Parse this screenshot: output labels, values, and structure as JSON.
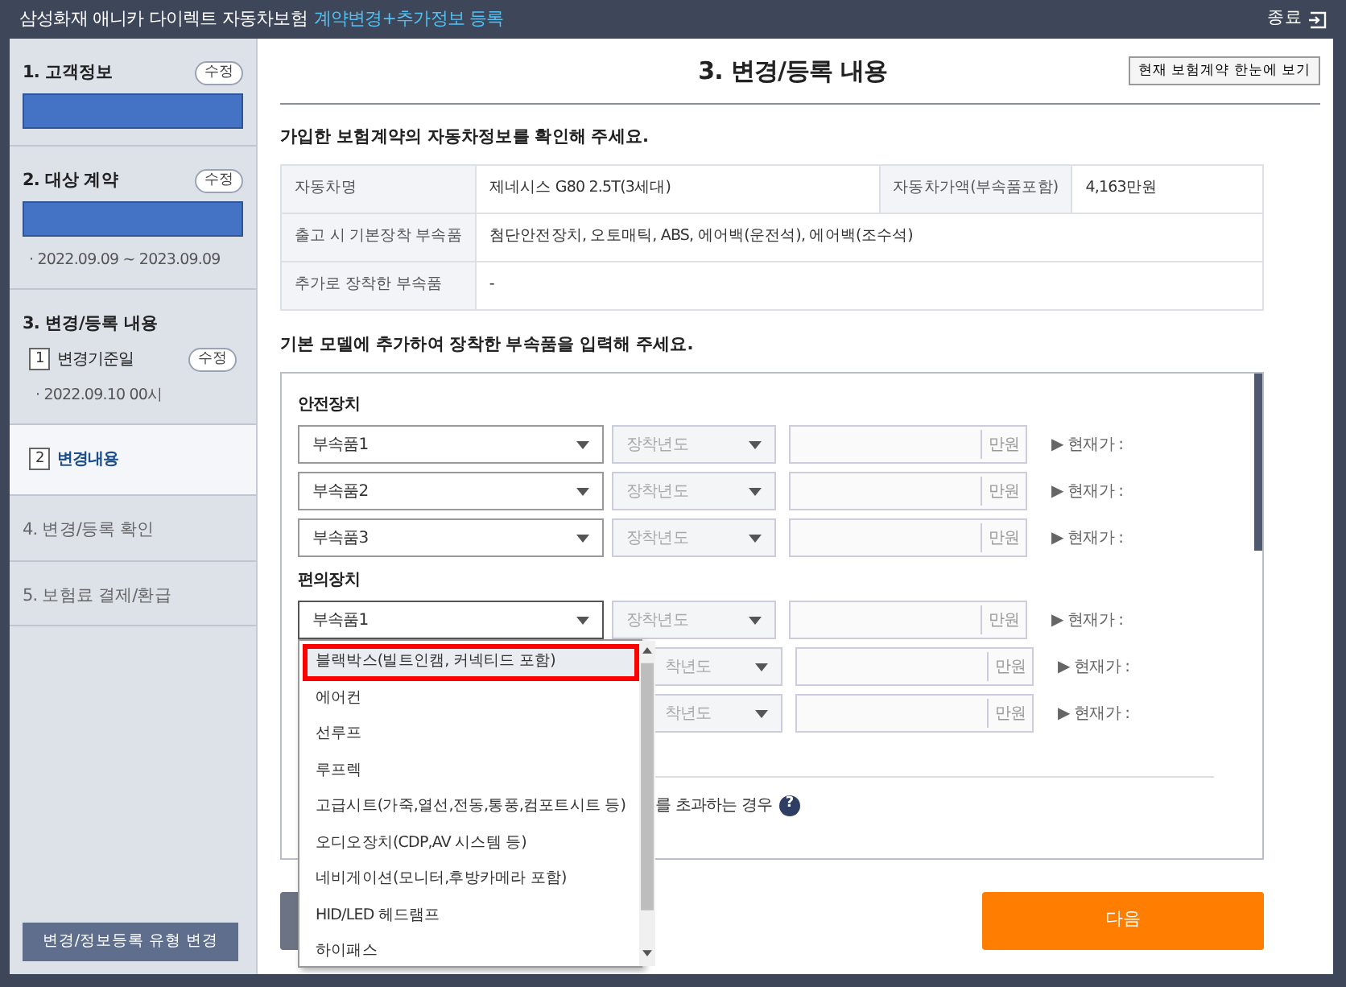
{
  "header": {
    "title": "삼성화재 애니카 다이렉트 자동차보험",
    "subtitle": "계약변경+추가정보 등록",
    "close_label": "종료"
  },
  "sidebar": {
    "steps": [
      {
        "label": "1. 고객정보",
        "disabled": false,
        "edit_label": "수정",
        "redacted": true
      },
      {
        "label": "2. 대상 계약",
        "disabled": false,
        "edit_label": "수정",
        "redacted": true,
        "note": "· 2022.09.09 ~ 2023.09.09"
      },
      {
        "label": "3. 변경/등록 내용",
        "disabled": false,
        "substeps": [
          {
            "number": "1",
            "label": "변경기준일",
            "edit_label": "수정",
            "note": "· 2022.09.10 00시",
            "selected": false
          },
          {
            "number": "2",
            "label": "변경내용",
            "selected": true
          }
        ]
      },
      {
        "label": "4. 변경/등록 확인",
        "disabled": true
      },
      {
        "label": "5. 보험료 결제/환급",
        "disabled": true
      }
    ],
    "bottom_button": "변경/정보등록 유형 변경"
  },
  "main": {
    "title": "3. 변경/등록 내용",
    "summary_button": "현재 보험계약 한눈에 보기",
    "car_heading": "가입한 보험계약의 자동차정보를 확인해 주세요.",
    "car_table": [
      {
        "label": "자동차명",
        "value": "제네시스 G80 2.5T(3세대)",
        "label_2": "자동차가액(부속품포함)",
        "value_2": "4,163만원"
      },
      {
        "label": "출고 시 기본장착 부속품",
        "value": "첨단안전장치, 오토매틱, ABS, 에어백(운전석), 에어백(조수석)"
      },
      {
        "label": "추가로 장착한 부속품",
        "value": "-"
      }
    ],
    "parts_heading": "기본 모델에 추가하여 장착한 부속품을 입력해 주세요.",
    "groups": [
      {
        "title": "안전장치",
        "rows": [
          {
            "part": "부속품1",
            "year_placeholder": "장착년도",
            "unit": "만원",
            "price_label": "▶ 현재가 :",
            "expanded": false
          },
          {
            "part": "부속품2",
            "year_placeholder": "장착년도",
            "unit": "만원",
            "price_label": "▶ 현재가 :",
            "expanded": false
          },
          {
            "part": "부속품3",
            "year_placeholder": "장착년도",
            "unit": "만원",
            "price_label": "▶ 현재가 :",
            "expanded": false
          }
        ]
      },
      {
        "title": "편의장치",
        "rows": [
          {
            "part": "부속품1",
            "year_placeholder": "장착년도",
            "unit": "만원",
            "price_label": "▶ 현재가 :",
            "expanded": true
          },
          {
            "year_placeholder": "착년도",
            "unit": "만원",
            "price_label": "▶ 현재가 :"
          },
          {
            "year_placeholder": "착년도",
            "unit": "만원",
            "price_label": "▶ 현재가 :"
          }
        ]
      }
    ],
    "note": "를 초과하는 경우",
    "help_glyph": "?",
    "next_button": "다음",
    "dropdown": [
      {
        "label": "블랙박스(빌트인캠, 커넥티드 포함)",
        "selected": true,
        "highlighted": true
      },
      {
        "label": "에어컨",
        "selected": false,
        "highlighted": false
      },
      {
        "label": "선루프",
        "selected": false,
        "highlighted": false
      },
      {
        "label": "루프렉",
        "selected": false,
        "highlighted": false
      },
      {
        "label": "고급시트(가죽,열선,전동,통풍,컴포트시트 등)",
        "selected": false,
        "highlighted": false
      },
      {
        "label": "오디오장치(CDP,AV 시스템 등)",
        "selected": false,
        "highlighted": false
      },
      {
        "label": "네비게이션(모니터,후방카메라 포함)",
        "selected": false,
        "highlighted": false
      },
      {
        "label": "HID/LED 헤드램프",
        "selected": false,
        "highlighted": false
      },
      {
        "label": "하이패스",
        "selected": false,
        "highlighted": false
      }
    ]
  }
}
